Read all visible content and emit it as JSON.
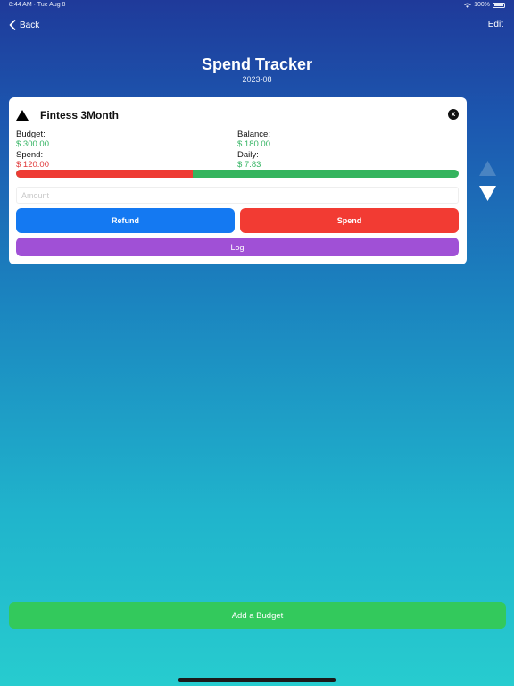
{
  "status_bar": {
    "time": "8:44 AM",
    "date": "Tue Aug 8",
    "battery": "100%"
  },
  "nav": {
    "back_label": "Back",
    "edit_label": "Edit"
  },
  "header": {
    "title": "Spend Tracker",
    "subtitle": "2023-08"
  },
  "budget": {
    "name": "Fintess 3Month",
    "close_label": "x",
    "budget_label": "Budget:",
    "budget_value": "$ 300.00",
    "balance_label": "Balance:",
    "balance_value": "$ 180.00",
    "spend_label": "Spend:",
    "spend_value": "$ 120.00",
    "daily_label": "Daily:",
    "daily_value": "$ 7.83",
    "progress_fraction": 0.4,
    "amount_placeholder": "Amount",
    "amount_value": "",
    "refund_label": "Refund",
    "spend_button_label": "Spend",
    "log_label": "Log"
  },
  "footer": {
    "add_budget_label": "Add a Budget"
  },
  "colors": {
    "refund": "#1479f2",
    "spend": "#f23b33",
    "log": "#a050d6",
    "add": "#33c95c",
    "positive": "#35b463",
    "negative": "#e0393a"
  },
  "icons": {
    "back": "chevron-left-icon",
    "collapse": "triangle-up-icon",
    "close": "close-icon",
    "move_up": "arrow-up-icon",
    "move_down": "arrow-down-icon"
  }
}
